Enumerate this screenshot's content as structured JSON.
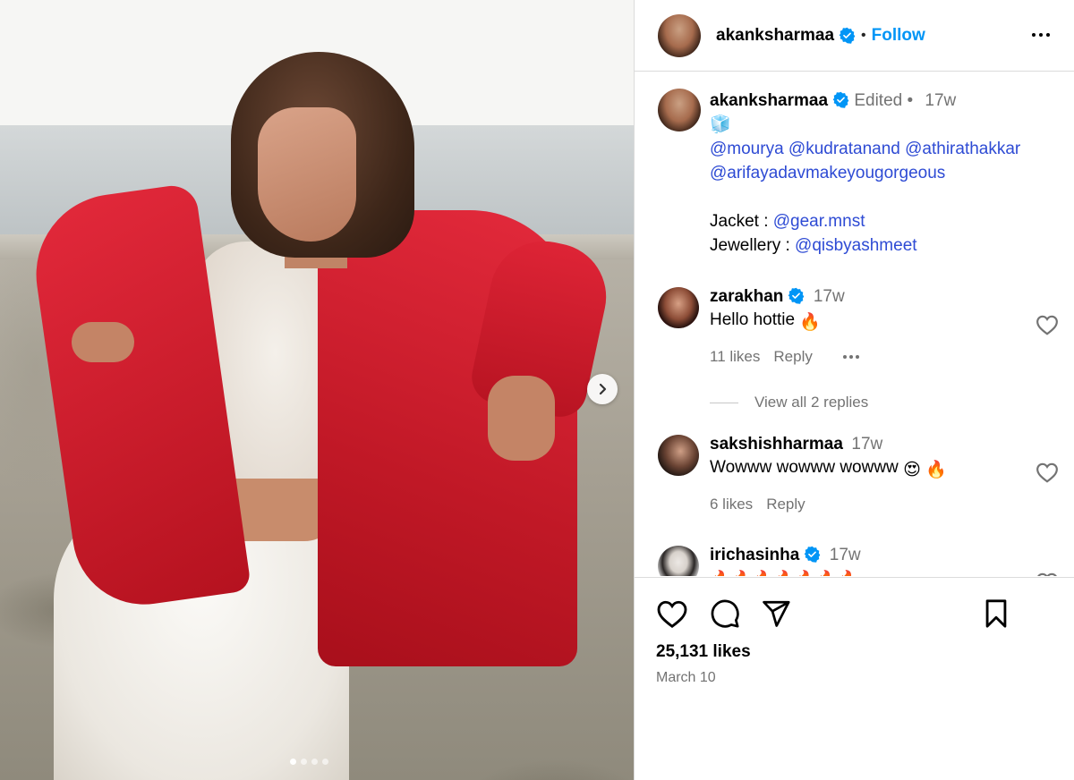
{
  "post": {
    "author": "akanksharmaa",
    "follow_label": "Follow",
    "caption": {
      "edited_label": "Edited",
      "age": "17w",
      "emoji": "🧊",
      "mentions_line1": "@mourya @kudratanand @athirathakkar",
      "mentions_line2": "@arifayadavmakeyougorgeous",
      "jacket_label": "Jacket : ",
      "jacket_handle": "@gear.mnst",
      "jewellery_label": "Jewellery : ",
      "jewellery_handle": "@qisbyashmeet"
    },
    "carousel": {
      "total": 4,
      "active": 1
    }
  },
  "comments": [
    {
      "user": "zarakhan",
      "verified": true,
      "age": "17w",
      "text": "Hello hottie",
      "emoji": "🔥",
      "likes": "11 likes",
      "reply_label": "Reply",
      "view_replies": "View all 2 replies"
    },
    {
      "user": "sakshishharmaa",
      "verified": false,
      "age": "17w",
      "text": "Wowww wowww wowww",
      "emoji": "😍 🔥",
      "likes": "6 likes",
      "reply_label": "Reply"
    },
    {
      "user": "irichasinha",
      "verified": true,
      "age": "17w",
      "text": "🔥🔥🔥🔥🔥🔥🔥"
    }
  ],
  "footer": {
    "likes": "25,131 likes",
    "date": "March 10"
  },
  "icons": [
    "like-icon",
    "comment-icon",
    "share-icon",
    "save-icon",
    "more-options-icon",
    "verified-badge-icon",
    "next-arrow-icon"
  ],
  "colors": {
    "follow": "#0095f6",
    "verified": "#0095f6",
    "mention": "#2e4bd4",
    "secondary_text": "#737373",
    "divider": "#dbdbdb"
  }
}
